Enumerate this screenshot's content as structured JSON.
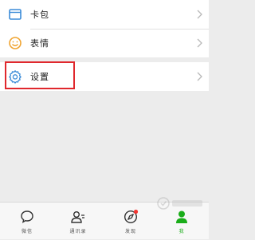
{
  "menu": {
    "group1": [
      {
        "label": "卡包",
        "icon": "card-icon"
      },
      {
        "label": "表情",
        "icon": "emoji-icon"
      }
    ],
    "group2": [
      {
        "label": "设置",
        "icon": "gear-icon"
      }
    ]
  },
  "tabbar": {
    "items": [
      {
        "label": "微信",
        "icon": "chat-bubble-icon"
      },
      {
        "label": "通讯录",
        "icon": "contacts-icon"
      },
      {
        "label": "发现",
        "icon": "compass-icon"
      },
      {
        "label": "我",
        "icon": "person-icon"
      }
    ],
    "active_index": 3
  },
  "colors": {
    "accent_green": "#1aad19",
    "highlight_red": "#e0282d",
    "card_blue": "#3b8cd8",
    "emoji_orange": "#f0a431"
  }
}
